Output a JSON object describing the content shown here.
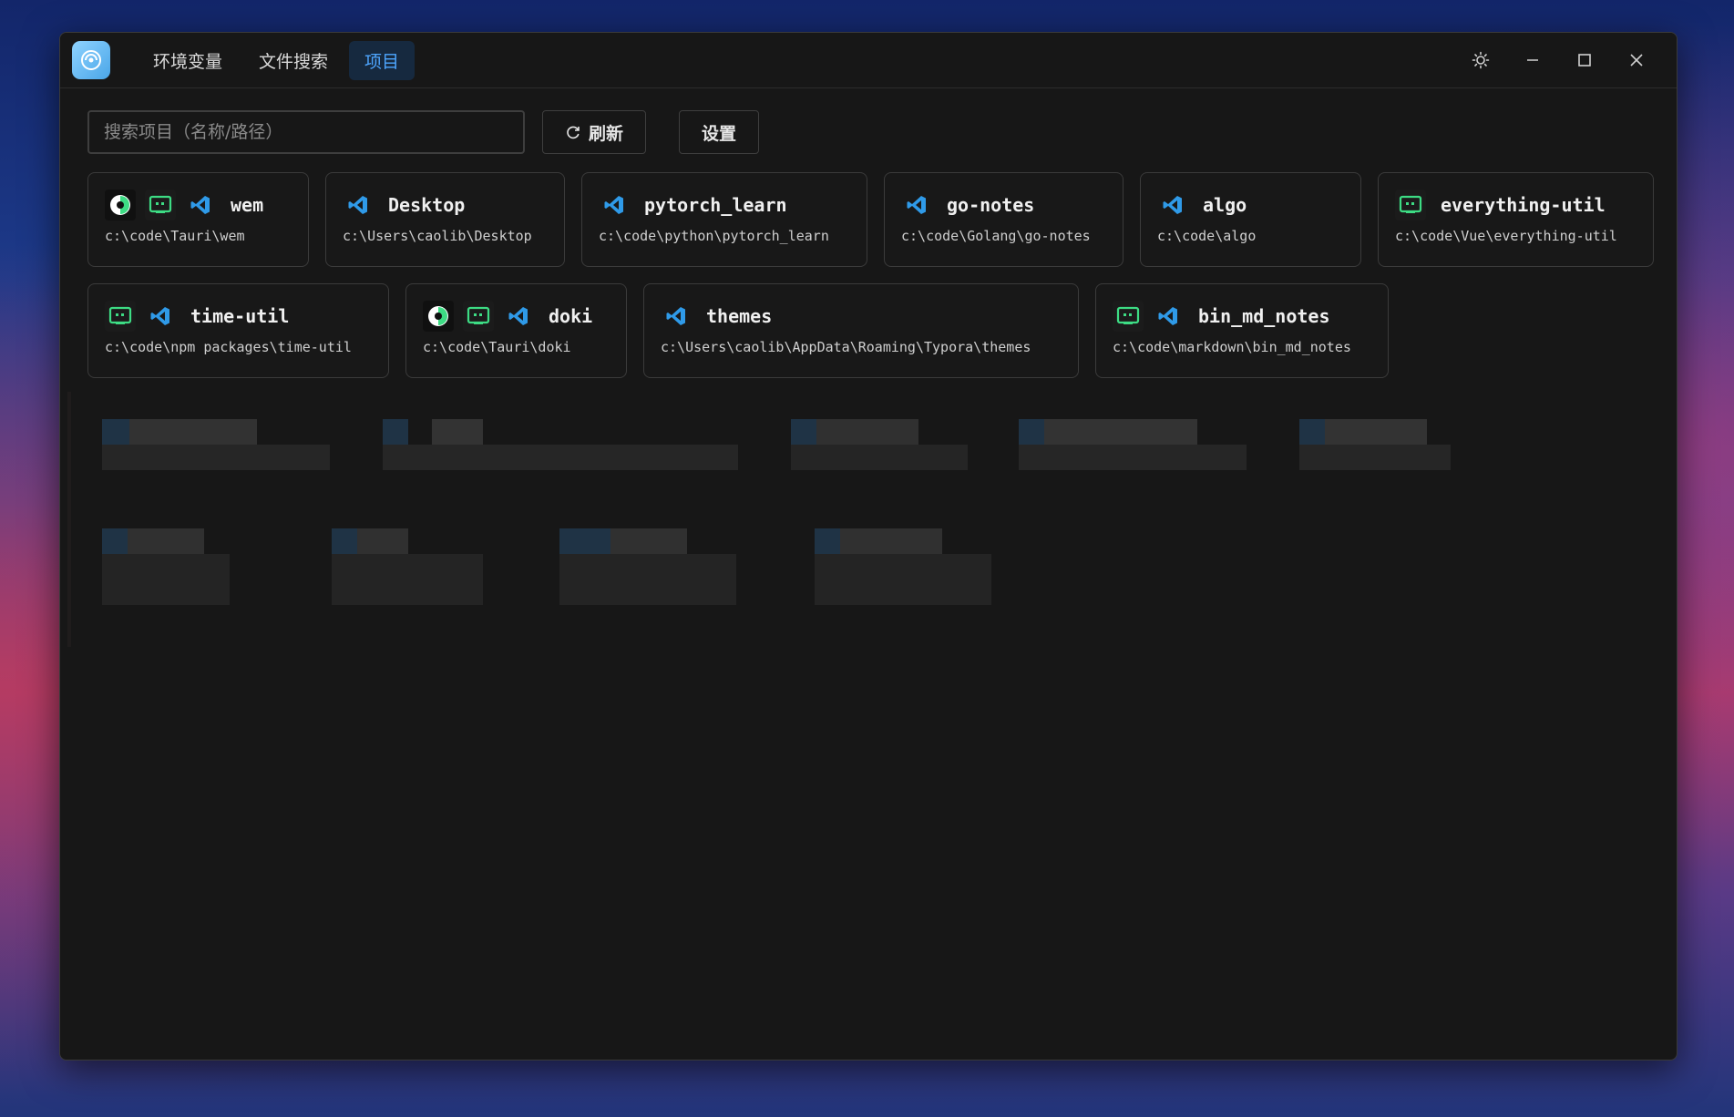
{
  "window": {
    "tabs": [
      {
        "label": "环境变量",
        "active": false
      },
      {
        "label": "文件搜索",
        "active": false
      },
      {
        "label": "项目",
        "active": true
      }
    ]
  },
  "toolbar": {
    "search_placeholder": "搜索项目（名称/路径）",
    "refresh_label": "刷新",
    "settings_label": "设置"
  },
  "projects": [
    {
      "name": "wem",
      "path": "c:\\code\\Tauri\\wem",
      "icons": [
        "android-studio-icon",
        "terminal-icon",
        "vscode-icon"
      ]
    },
    {
      "name": "Desktop",
      "path": "c:\\Users\\caolib\\Desktop",
      "icons": [
        "vscode-icon"
      ]
    },
    {
      "name": "pytorch_learn",
      "path": "c:\\code\\python\\pytorch_learn",
      "icons": [
        "vscode-icon"
      ]
    },
    {
      "name": "go-notes",
      "path": "c:\\code\\Golang\\go-notes",
      "icons": [
        "vscode-icon"
      ]
    },
    {
      "name": "algo",
      "path": "c:\\code\\algo",
      "icons": [
        "vscode-icon"
      ]
    },
    {
      "name": "everything-util",
      "path": "c:\\code\\Vue\\everything-util",
      "icons": [
        "terminal-icon"
      ]
    },
    {
      "name": "time-util",
      "path": "c:\\code\\npm packages\\time-util",
      "icons": [
        "terminal-icon",
        "vscode-icon"
      ]
    },
    {
      "name": "doki",
      "path": "c:\\code\\Tauri\\doki",
      "icons": [
        "android-studio-icon",
        "terminal-icon",
        "vscode-icon"
      ]
    },
    {
      "name": "themes",
      "path": "c:\\Users\\caolib\\AppData\\Roaming\\Typora\\themes",
      "icons": [
        "vscode-icon"
      ]
    },
    {
      "name": "bin_md_notes",
      "path": "c:\\code\\markdown\\bin_md_notes",
      "icons": [
        "terminal-icon",
        "vscode-icon"
      ]
    }
  ],
  "colors": {
    "accent": "#4ea6ff",
    "vscode": "#2f9ae8",
    "terminal": "#3ddc84",
    "window_bg": "#171717"
  }
}
